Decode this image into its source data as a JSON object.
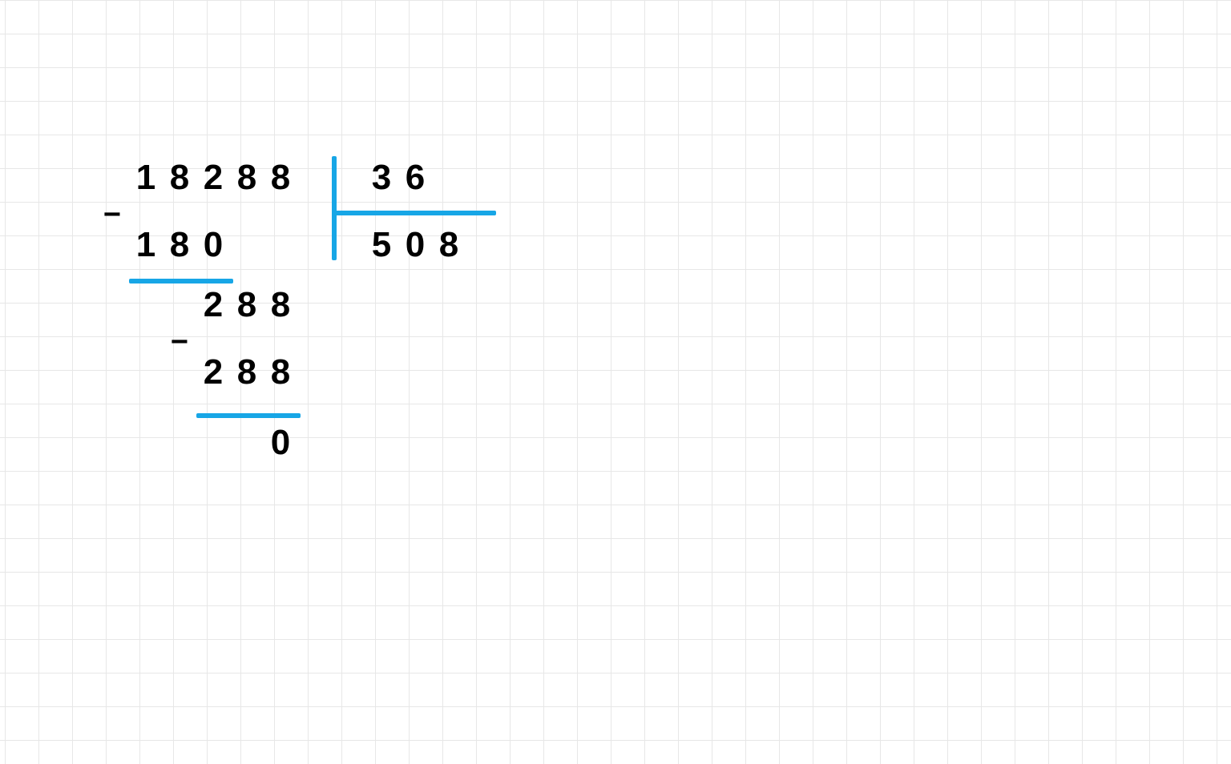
{
  "division": {
    "dividend_digits": [
      "1",
      "8",
      "2",
      "8",
      "8"
    ],
    "divisor_digits": [
      "3",
      "6"
    ],
    "quotient_digits": [
      "5",
      "0",
      "8"
    ],
    "step1_minus": "−",
    "step1_sub_digits": [
      "1",
      "8",
      "0"
    ],
    "step2_minus": "−",
    "step2_carry_digits": [
      "2",
      "8",
      "8"
    ],
    "step2_sub_digits": [
      "2",
      "8",
      "8"
    ],
    "remainder_digits": [
      "0"
    ]
  }
}
